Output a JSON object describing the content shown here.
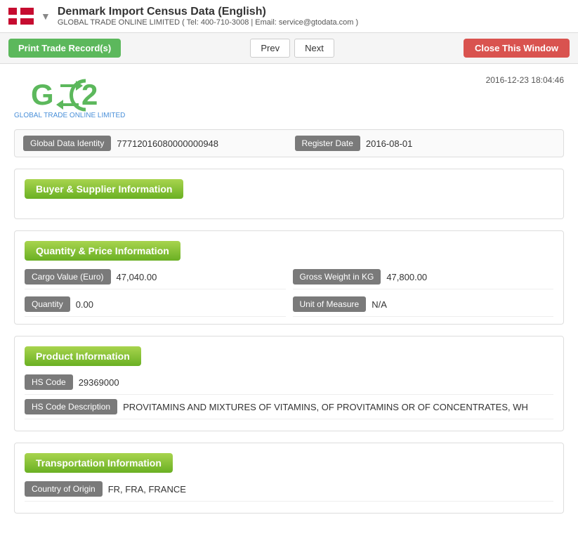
{
  "header": {
    "title": "Denmark Import Census Data (English)",
    "subtitle": "GLOBAL TRADE ONLINE LIMITED ( Tel: 400-710-3008 | Email: service@gtodata.com )",
    "dropdown_arrow": "▼"
  },
  "toolbar": {
    "print_label": "Print Trade Record(s)",
    "prev_label": "Prev",
    "next_label": "Next",
    "close_label": "Close This Window"
  },
  "logo": {
    "company_name": "GLOBAL TRADE ONLINE LIMITED",
    "timestamp": "2016-12-23 18:04:46"
  },
  "global_data": {
    "identity_label": "Global Data Identity",
    "identity_value": "77712016080000000948",
    "register_label": "Register Date",
    "register_value": "2016-08-01"
  },
  "sections": {
    "buyer_supplier": {
      "title": "Buyer & Supplier Information"
    },
    "quantity_price": {
      "title": "Quantity & Price Information",
      "fields": [
        {
          "label": "Cargo Value (Euro)",
          "value": "47,040.00"
        },
        {
          "label": "Gross Weight in KG",
          "value": "47,800.00"
        },
        {
          "label": "Quantity",
          "value": "0.00"
        },
        {
          "label": "Unit of Measure",
          "value": "N/A"
        }
      ]
    },
    "product": {
      "title": "Product Information",
      "fields": [
        {
          "label": "HS Code",
          "value": "29369000"
        },
        {
          "label": "HS Code Description",
          "value": "PROVITAMINS AND MIXTURES OF VITAMINS, OF PROVITAMINS OR OF CONCENTRATES, WH"
        }
      ]
    },
    "transportation": {
      "title": "Transportation Information",
      "fields": [
        {
          "label": "Country of Origin",
          "value": "FR, FRA, FRANCE"
        }
      ]
    }
  },
  "colors": {
    "green": "#6ab023",
    "green_btn": "#5cb85c",
    "red_btn": "#d9534f",
    "flag_red": "#c60c30"
  }
}
